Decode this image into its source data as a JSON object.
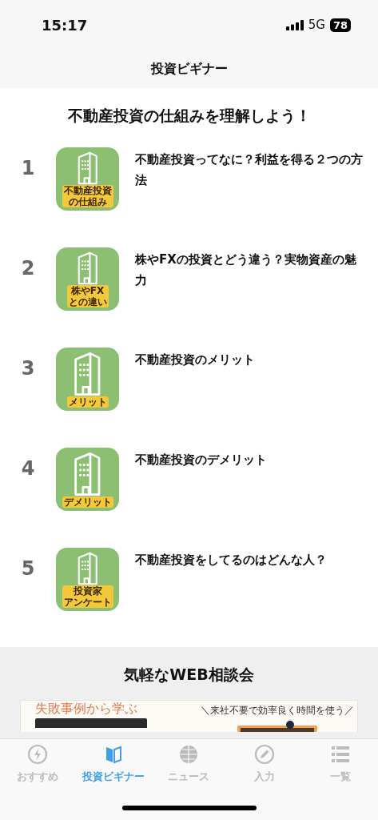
{
  "status_bar": {
    "time": "15:17",
    "network": "5G",
    "battery": "78"
  },
  "header": {
    "title": "投資ビギナー"
  },
  "section": {
    "title": "不動産投資の仕組みを理解しよう！",
    "articles": [
      {
        "number": "1",
        "thumb_label": [
          "不動産投資",
          "の仕組み"
        ],
        "title": "不動産投資ってなに？利益を得る２つの方法"
      },
      {
        "number": "2",
        "thumb_label": [
          "株やFX",
          "との違い"
        ],
        "title": "株やFXの投資とどう違う？実物資産の魅力"
      },
      {
        "number": "3",
        "thumb_label": [
          "メリット"
        ],
        "title": "不動産投資のメリット"
      },
      {
        "number": "4",
        "thumb_label": [
          "デメリット"
        ],
        "title": "不動産投資のデメリット"
      },
      {
        "number": "5",
        "thumb_label": [
          "投資家",
          "アンケート"
        ],
        "title": "不動産投資をしてるのはどんな人？"
      }
    ]
  },
  "consult": {
    "title": "気軽なWEB相談会",
    "banner": {
      "subtitle": "失敗事例から学ぶ",
      "tagline": "＼来社不要で効率良く時間を使う／"
    }
  },
  "tabs": [
    {
      "label": "おすすめ",
      "selected": false
    },
    {
      "label": "投資ビギナー",
      "selected": true
    },
    {
      "label": "ニュース",
      "selected": false
    },
    {
      "label": "入力",
      "selected": false
    },
    {
      "label": "一覧",
      "selected": false
    }
  ]
}
